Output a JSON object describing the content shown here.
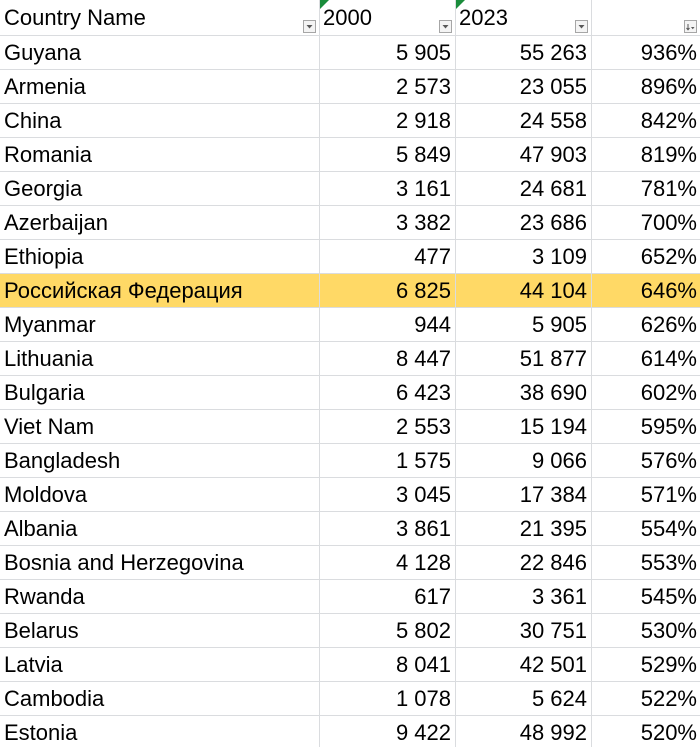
{
  "sheet": {
    "columns": [
      "Country Name",
      "2000",
      "2023",
      ""
    ],
    "rows": [
      {
        "name": "Guyana",
        "y2000": "5 905",
        "y2023": "55 263",
        "pct": "936%"
      },
      {
        "name": "Armenia",
        "y2000": "2 573",
        "y2023": "23 055",
        "pct": "896%"
      },
      {
        "name": "China",
        "y2000": "2 918",
        "y2023": "24 558",
        "pct": "842%"
      },
      {
        "name": "Romania",
        "y2000": "5 849",
        "y2023": "47 903",
        "pct": "819%"
      },
      {
        "name": "Georgia",
        "y2000": "3 161",
        "y2023": "24 681",
        "pct": "781%"
      },
      {
        "name": "Azerbaijan",
        "y2000": "3 382",
        "y2023": "23 686",
        "pct": "700%"
      },
      {
        "name": "Ethiopia",
        "y2000": "477",
        "y2023": "3 109",
        "pct": "652%"
      },
      {
        "name": "Российская Федерация",
        "y2000": "6 825",
        "y2023": "44 104",
        "pct": "646%"
      },
      {
        "name": "Myanmar",
        "y2000": "944",
        "y2023": "5 905",
        "pct": "626%"
      },
      {
        "name": "Lithuania",
        "y2000": "8 447",
        "y2023": "51 877",
        "pct": "614%"
      },
      {
        "name": "Bulgaria",
        "y2000": "6 423",
        "y2023": "38 690",
        "pct": "602%"
      },
      {
        "name": "Viet Nam",
        "y2000": "2 553",
        "y2023": "15 194",
        "pct": "595%"
      },
      {
        "name": "Bangladesh",
        "y2000": "1 575",
        "y2023": "9 066",
        "pct": "576%"
      },
      {
        "name": "Moldova",
        "y2000": "3 045",
        "y2023": "17 384",
        "pct": "571%"
      },
      {
        "name": "Albania",
        "y2000": "3 861",
        "y2023": "21 395",
        "pct": "554%"
      },
      {
        "name": "Bosnia and Herzegovina",
        "y2000": "4 128",
        "y2023": "22 846",
        "pct": "553%"
      },
      {
        "name": "Rwanda",
        "y2000": "617",
        "y2023": "3 361",
        "pct": "545%"
      },
      {
        "name": "Belarus",
        "y2000": "5 802",
        "y2023": "30 751",
        "pct": "530%"
      },
      {
        "name": "Latvia",
        "y2000": "8 041",
        "y2023": "42 501",
        "pct": "529%"
      },
      {
        "name": "Cambodia",
        "y2000": "1 078",
        "y2023": "5 624",
        "pct": "522%"
      },
      {
        "name": "Estonia",
        "y2000": "9 422",
        "y2023": "48 992",
        "pct": "520%"
      }
    ],
    "highlighted_row": 7,
    "highlight_color": "#ffd966",
    "flag_color": "#1a8c3b",
    "gridline_color": "#dadcdf",
    "filter_icons": [
      "filter-dropdown-icon",
      "filter-dropdown-icon",
      "filter-dropdown-icon",
      "sort-descending-filter-icon"
    ]
  }
}
